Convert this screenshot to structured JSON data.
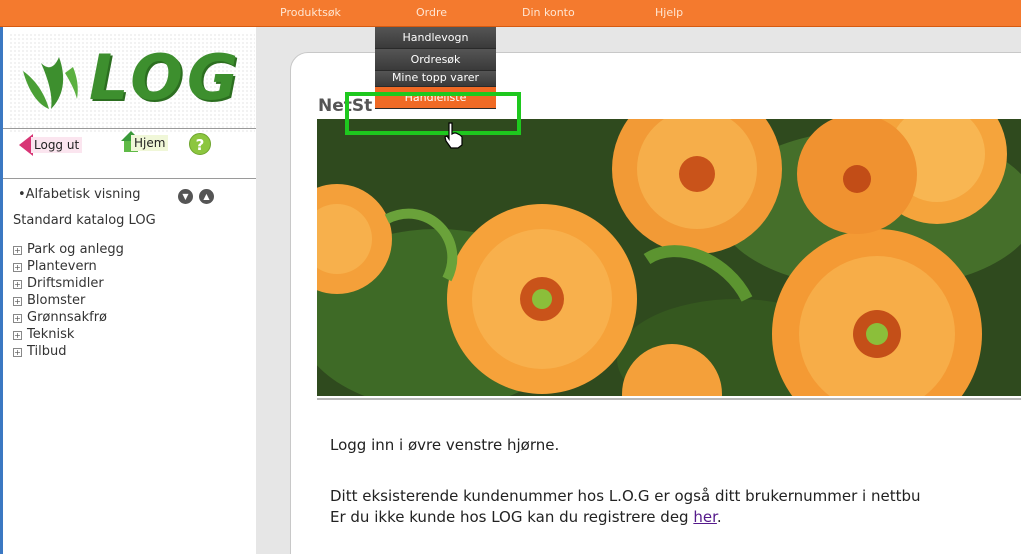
{
  "nav": {
    "items": [
      "Produktsøk",
      "Ordre",
      "Din konto",
      "Hjelp"
    ]
  },
  "dropdown": {
    "items": [
      "Handlevogn",
      "Ordresøk",
      "Mine topp varer",
      "Handleliste"
    ],
    "active_index": 3
  },
  "logo": {
    "text": "LOG"
  },
  "sidebar": {
    "logout_label": "Logg ut",
    "home_label": "Hjem",
    "help_label": "?",
    "alpha_label": "•Alfabetisk visning",
    "catalog_title": "Standard katalog LOG",
    "tree": [
      "Park og anlegg",
      "Plantevern",
      "Driftsmidler",
      "Blomster",
      "Grønnsakfrø",
      "Teknisk",
      "Tilbud"
    ]
  },
  "main": {
    "title": "NetSt",
    "para1": "Logg inn i øvre venstre hjørne.",
    "para2a": "Ditt eksisterende kundenummer hos L.O.G er også ditt brukernummer i nettbu",
    "para2b_prefix": "Er du ikke kunde hos LOG kan du registrere deg ",
    "para2b_link": "her",
    "para2b_suffix": "."
  },
  "colors": {
    "topbar": "#f47a2e",
    "accent_green": "#1ec81e",
    "left_border": "#3b78c2"
  }
}
